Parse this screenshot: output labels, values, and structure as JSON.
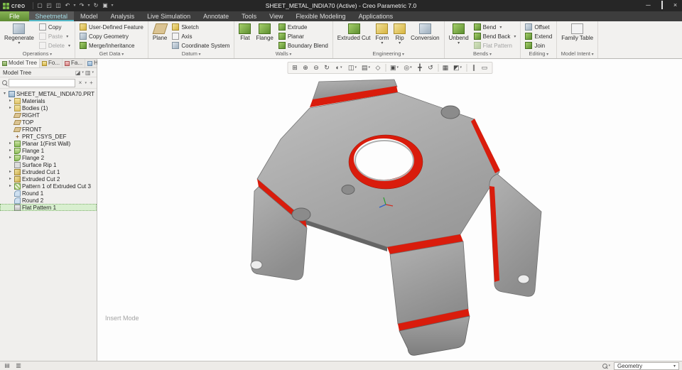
{
  "colors": {
    "highlight_red": "#d91c0c",
    "selection_green": "#d8efcf",
    "file_tab_green": "#6f9c3f",
    "part_gray": "#a8a8a8",
    "active_tab_teal": "#53b7c6"
  },
  "titlebar": {
    "logo_text": "creo",
    "title": "SHEET_METAL_INDIA70 (Active) - Creo Parametric 7.0"
  },
  "icons": {
    "new_file": "▢",
    "open": "◰",
    "save": "◫",
    "undo": "↶",
    "redo": "↷",
    "regenerate": "↻",
    "windows": "▣",
    "caret": "▾",
    "minimize": "─",
    "close": "×",
    "refit": "⊞",
    "zoom_in": "⊕",
    "zoom_out": "⊖",
    "repaint": "↻",
    "shading": "◐",
    "display_style": "◫",
    "saved_views": "▤",
    "perspective": "◇",
    "datum_display": "▣",
    "annotations": "◎",
    "spin_center": "╋",
    "orient_mode": "↺",
    "view_manager": "▦",
    "render_style": "◩",
    "pause": "∥",
    "more_tools": "▭",
    "tree_settings": "◪",
    "tree_columns": "▥",
    "filter_clear": "×",
    "filter_add": "+",
    "panel_toggle": "▤",
    "browser_toggle": "▥"
  },
  "tabs": {
    "file": "File",
    "items": [
      "Sheetmetal",
      "Model",
      "Analysis",
      "Live Simulation",
      "Annotate",
      "Tools",
      "View",
      "Flexible Modeling",
      "Applications"
    ]
  },
  "ribbon": {
    "operations": {
      "label": "Operations",
      "regenerate": "Regenerate",
      "copy": "Copy",
      "paste": "Paste",
      "del": "Delete"
    },
    "get_data": {
      "label": "Get Data",
      "udf": "User-Defined Feature",
      "copy_geometry": "Copy Geometry",
      "merge": "Merge/Inheritance"
    },
    "datum": {
      "label": "Datum",
      "plane": "Plane",
      "sketch": "Sketch",
      "axis": "Axis",
      "csys": "Coordinate System"
    },
    "walls": {
      "label": "Walls",
      "flat": "Flat",
      "flange": "Flange",
      "extrude": "Extrude",
      "planar": "Planar",
      "boundary_blend": "Boundary Blend"
    },
    "engineering": {
      "label": "Engineering",
      "extruded_cut": "Extruded Cut",
      "form": "Form",
      "rip": "Rip",
      "conversion": "Conversion"
    },
    "bends": {
      "label": "Bends",
      "unbend": "Unbend",
      "bend": "Bend",
      "bend_back": "Bend Back",
      "flat_pattern": "Flat Pattern"
    },
    "editing": {
      "label": "Editing",
      "offset": "Offset",
      "extend": "Extend",
      "join": "Join"
    },
    "model_intent": {
      "label": "Model Intent",
      "family_table": "Family Table"
    }
  },
  "navigator": {
    "model_tree_tab": "Model Tree",
    "folder_tab": "Fo...",
    "favorites_tab": "Fa...",
    "history_tab": "Hi...",
    "header": "Model Tree"
  },
  "model_tree": {
    "items": [
      "SHEET_METAL_INDIA70.PRT",
      "Materials",
      "Bodies (1)",
      "RIGHT",
      "TOP",
      "FRONT",
      "PRT_CSYS_DEF",
      "Planar 1(First Wall)",
      "Flange 1",
      "Flange 2",
      "Surface Rip 1",
      "Extruded Cut 1",
      "Extruded Cut 2",
      "Pattern 1 of Extruded Cut 3",
      "Round 1",
      "Round 2",
      "Flat Pattern 1"
    ]
  },
  "graphics": {
    "insert_mode_label": "Insert Mode"
  },
  "statusbar": {
    "geometry_filter": "Geometry"
  }
}
